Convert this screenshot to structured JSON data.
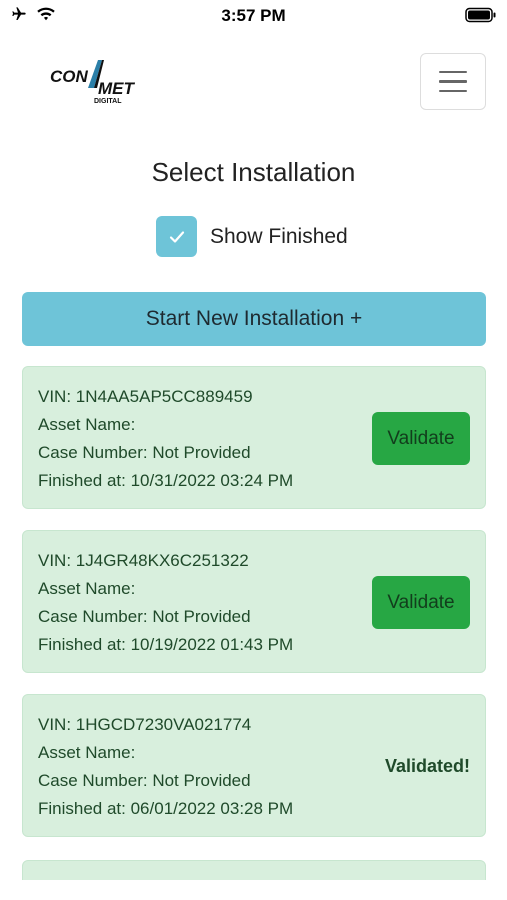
{
  "status_bar": {
    "time": "3:57 PM",
    "icons": [
      "airplane-icon",
      "wifi-icon",
      "battery-icon"
    ]
  },
  "header": {
    "logo_text": "CON MET DIGITAL",
    "menu_icon": "hamburger-menu-icon"
  },
  "page": {
    "title": "Select Installation",
    "show_finished_label": "Show Finished",
    "show_finished_checked": true,
    "start_button_label": "Start New Installation +"
  },
  "colors": {
    "accent_blue": "#6ec4d8",
    "card_green": "#d8efdd",
    "button_green": "#27a744"
  },
  "installations": [
    {
      "vin": "VIN: 1N4AA5AP5CC889459",
      "asset_name": "Asset Name:",
      "case_number": "Case Number: Not Provided",
      "finished_at": "Finished at: 10/31/2022 03:24 PM",
      "action": "Validate"
    },
    {
      "vin": "VIN: 1J4GR48KX6C251322",
      "asset_name": "Asset Name:",
      "case_number": "Case Number: Not Provided",
      "finished_at": "Finished at: 10/19/2022 01:43 PM",
      "action": "Validate"
    },
    {
      "vin": "VIN: 1HGCD7230VA021774",
      "asset_name": "Asset Name:",
      "case_number": "Case Number: Not Provided",
      "finished_at": "Finished at: 06/01/2022 03:28 PM",
      "status": "Validated!"
    }
  ]
}
